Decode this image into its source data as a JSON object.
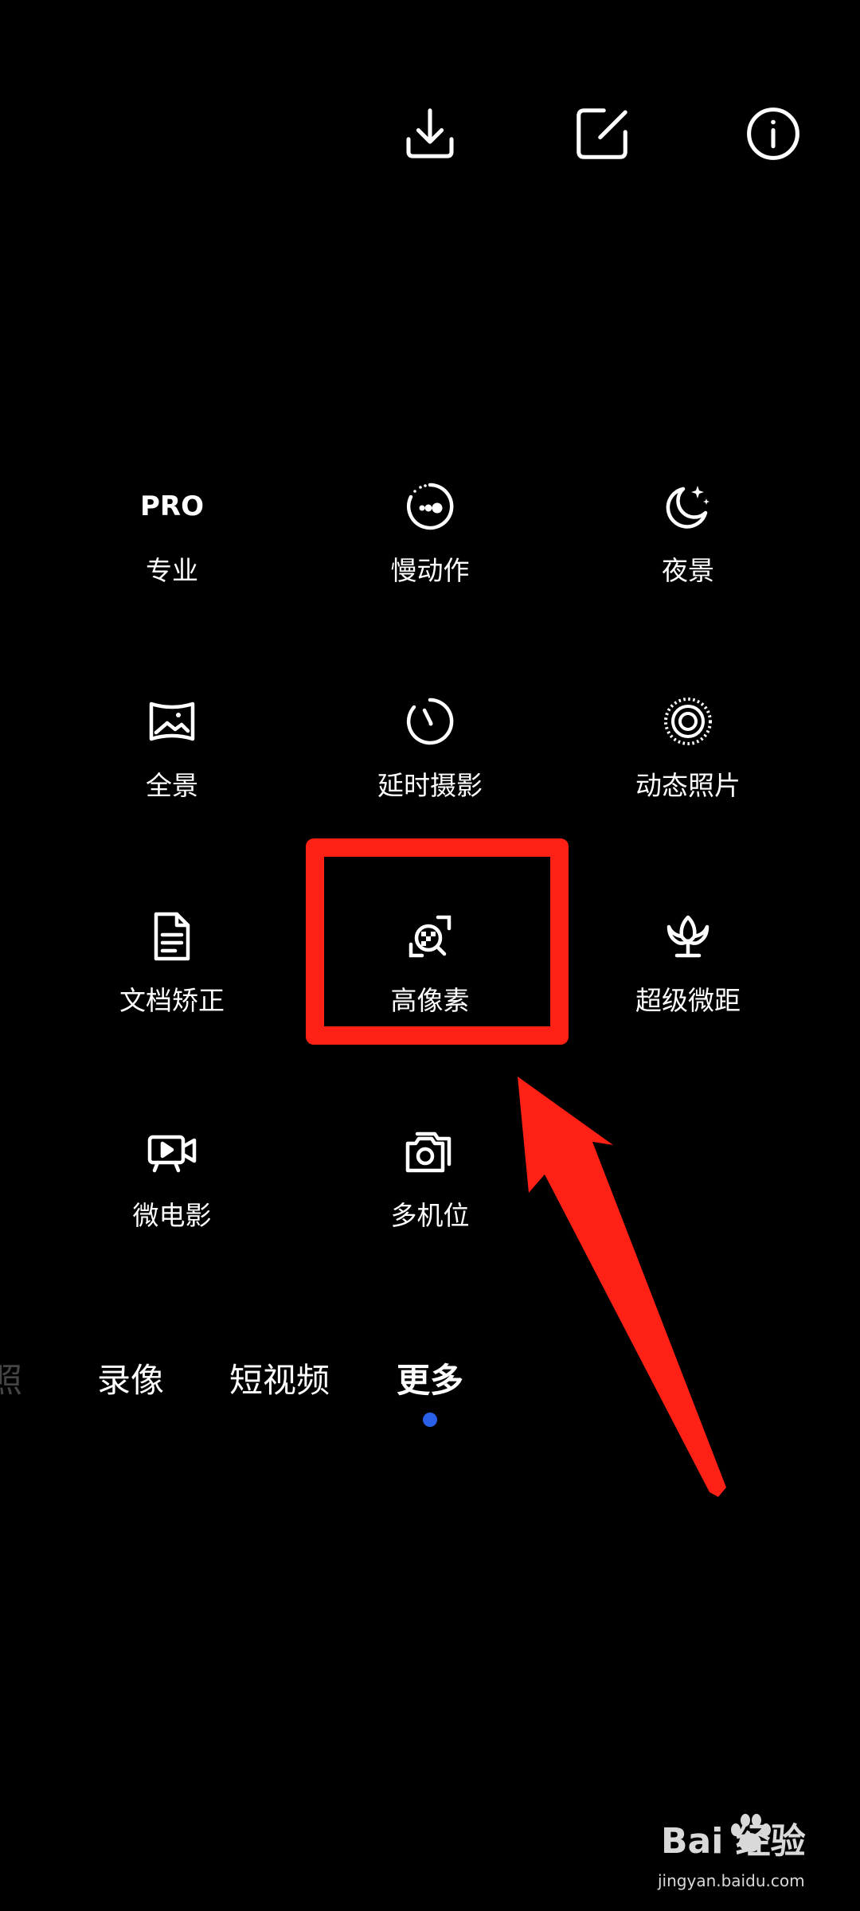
{
  "top_bar": {
    "icons": [
      "download-icon",
      "edit-icon",
      "info-icon"
    ]
  },
  "modes": [
    {
      "label": "专业",
      "badge": "PRO",
      "icon": "pro-text-icon"
    },
    {
      "label": "慢动作",
      "icon": "slow-motion-icon"
    },
    {
      "label": "夜景",
      "icon": "night-moon-icon"
    },
    {
      "label": "全景",
      "icon": "panorama-icon"
    },
    {
      "label": "延时摄影",
      "icon": "timelapse-icon"
    },
    {
      "label": "动态照片",
      "icon": "live-photo-icon"
    },
    {
      "label": "文档矫正",
      "icon": "document-icon"
    },
    {
      "label": "高像素",
      "icon": "high-pixel-icon"
    },
    {
      "label": "超级微距",
      "icon": "macro-flower-icon"
    },
    {
      "label": "微电影",
      "icon": "movie-camera-icon"
    },
    {
      "label": "多机位",
      "icon": "multi-camera-icon"
    }
  ],
  "tabs": [
    {
      "label": "照",
      "state": "faded"
    },
    {
      "label": "录像",
      "state": "normal"
    },
    {
      "label": "短视频",
      "state": "normal"
    },
    {
      "label": "更多",
      "state": "active"
    }
  ],
  "annotation": {
    "highlight_color": "#ff2016",
    "highlighted_mode": "高像素"
  },
  "watermark": {
    "brand": "Bai  经验",
    "url": "jingyan.baidu.com"
  },
  "colors": {
    "background": "#000000",
    "active_dot": "#2a5fe8"
  }
}
